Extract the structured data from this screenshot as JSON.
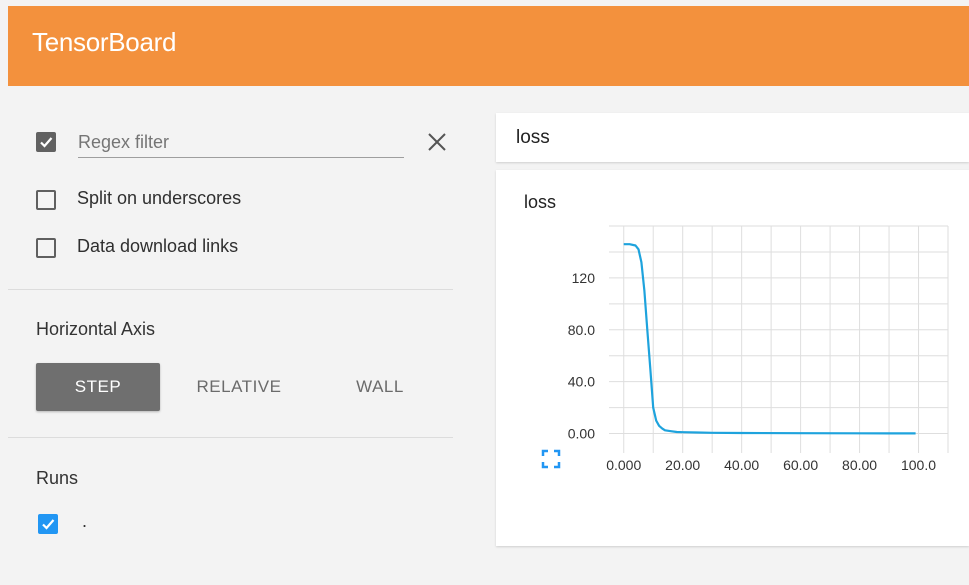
{
  "app": {
    "title": "TensorBoard"
  },
  "sidebar": {
    "regex_filter": {
      "checked": true,
      "placeholder": "Regex filter",
      "value": ""
    },
    "options": [
      {
        "label": "Split on underscores",
        "checked": false
      },
      {
        "label": "Data download links",
        "checked": false
      }
    ],
    "horizontal_axis": {
      "title": "Horizontal Axis",
      "buttons": [
        {
          "label": "STEP",
          "active": true
        },
        {
          "label": "RELATIVE",
          "active": false
        },
        {
          "label": "WALL",
          "active": false
        }
      ]
    },
    "runs": {
      "title": "Runs",
      "items": [
        {
          "label": ".",
          "checked": true
        }
      ]
    }
  },
  "main": {
    "tag_search": "loss",
    "chart_title": "loss"
  },
  "colors": {
    "header": "#f3913d",
    "line": "#1ea3dd",
    "checkbox_blue": "#2196f3"
  },
  "chart_data": {
    "type": "line",
    "title": "loss",
    "xlabel": "",
    "ylabel": "",
    "xlim": [
      -5,
      110
    ],
    "ylim": [
      -15,
      160
    ],
    "x_ticks": [
      "0.000",
      "20.00",
      "40.00",
      "60.00",
      "80.00",
      "100.0"
    ],
    "y_ticks": [
      "0.00",
      "40.0",
      "80.0",
      "120"
    ],
    "grid": true,
    "series": [
      {
        "x": [
          0,
          2,
          4,
          5,
          6,
          7,
          8,
          9,
          10,
          11,
          12,
          13,
          14,
          16,
          18,
          20,
          25,
          30,
          40,
          60,
          80,
          99
        ],
        "y": [
          146,
          146,
          145,
          142,
          132,
          110,
          80,
          50,
          20,
          10,
          6,
          4,
          2.5,
          1.8,
          1.2,
          1.0,
          0.8,
          0.6,
          0.4,
          0.3,
          0.2,
          0.1
        ]
      }
    ]
  }
}
